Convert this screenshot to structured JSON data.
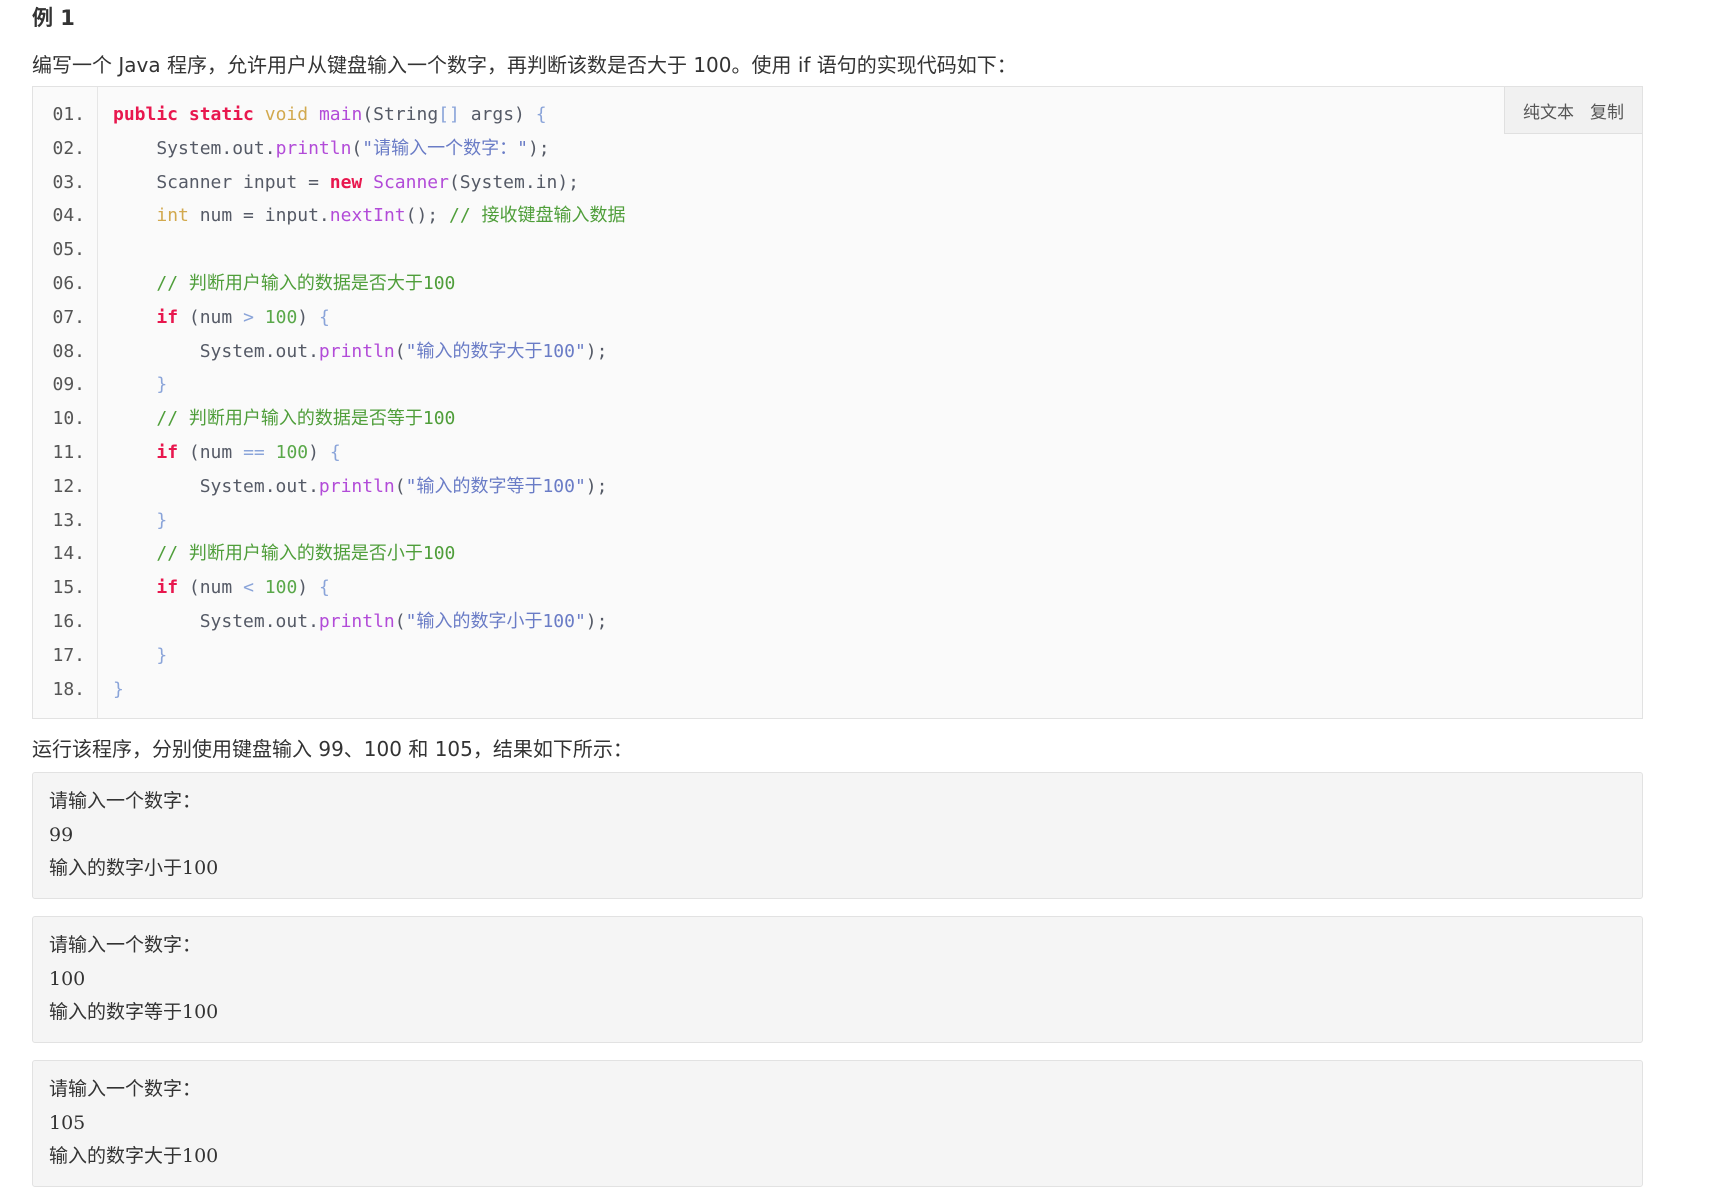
{
  "heading": "例 1",
  "intro": "编写一个 Java 程序，允许用户从键盘输入一个数字，再判断该数是否大于 100。使用 if 语句的实现代码如下：",
  "toolbar": {
    "plain_text_label": "纯文本",
    "copy_label": "复制"
  },
  "code": {
    "lines": [
      {
        "num": "01.",
        "tokens": [
          {
            "t": "public",
            "c": "keyword"
          },
          {
            "t": " ",
            "c": "plain"
          },
          {
            "t": "static",
            "c": "keyword"
          },
          {
            "t": " ",
            "c": "plain"
          },
          {
            "t": "void",
            "c": "type"
          },
          {
            "t": " ",
            "c": "plain"
          },
          {
            "t": "main",
            "c": "func"
          },
          {
            "t": "(String",
            "c": "plain"
          },
          {
            "t": "[]",
            "c": "punct"
          },
          {
            "t": " args) ",
            "c": "plain"
          },
          {
            "t": "{",
            "c": "punct"
          }
        ]
      },
      {
        "num": "02.",
        "tokens": [
          {
            "t": "    System.out.",
            "c": "plain"
          },
          {
            "t": "println",
            "c": "func"
          },
          {
            "t": "(",
            "c": "plain"
          },
          {
            "t": "\"请输入一个数字：\"",
            "c": "string"
          },
          {
            "t": ");",
            "c": "plain"
          }
        ]
      },
      {
        "num": "03.",
        "tokens": [
          {
            "t": "    Scanner input = ",
            "c": "plain"
          },
          {
            "t": "new",
            "c": "new"
          },
          {
            "t": " ",
            "c": "plain"
          },
          {
            "t": "Scanner",
            "c": "class"
          },
          {
            "t": "(System.in);",
            "c": "plain"
          }
        ]
      },
      {
        "num": "04.",
        "tokens": [
          {
            "t": "    ",
            "c": "plain"
          },
          {
            "t": "int",
            "c": "type"
          },
          {
            "t": " num = input.",
            "c": "plain"
          },
          {
            "t": "nextInt",
            "c": "func"
          },
          {
            "t": "(); ",
            "c": "plain"
          },
          {
            "t": "// 接收键盘输入数据",
            "c": "comment"
          }
        ]
      },
      {
        "num": "05.",
        "tokens": []
      },
      {
        "num": "06.",
        "tokens": [
          {
            "t": "    ",
            "c": "plain"
          },
          {
            "t": "// 判断用户输入的数据是否大于100",
            "c": "comment"
          }
        ]
      },
      {
        "num": "07.",
        "tokens": [
          {
            "t": "    ",
            "c": "plain"
          },
          {
            "t": "if",
            "c": "keyword"
          },
          {
            "t": " (num ",
            "c": "plain"
          },
          {
            "t": ">",
            "c": "punct"
          },
          {
            "t": " ",
            "c": "plain"
          },
          {
            "t": "100",
            "c": "number"
          },
          {
            "t": ") ",
            "c": "plain"
          },
          {
            "t": "{",
            "c": "punct"
          }
        ]
      },
      {
        "num": "08.",
        "tokens": [
          {
            "t": "        System.out.",
            "c": "plain"
          },
          {
            "t": "println",
            "c": "func"
          },
          {
            "t": "(",
            "c": "plain"
          },
          {
            "t": "\"输入的数字大于100\"",
            "c": "string"
          },
          {
            "t": ");",
            "c": "plain"
          }
        ]
      },
      {
        "num": "09.",
        "tokens": [
          {
            "t": "    ",
            "c": "plain"
          },
          {
            "t": "}",
            "c": "punct"
          }
        ]
      },
      {
        "num": "10.",
        "tokens": [
          {
            "t": "    ",
            "c": "plain"
          },
          {
            "t": "// 判断用户输入的数据是否等于100",
            "c": "comment"
          }
        ]
      },
      {
        "num": "11.",
        "tokens": [
          {
            "t": "    ",
            "c": "plain"
          },
          {
            "t": "if",
            "c": "keyword"
          },
          {
            "t": " (num ",
            "c": "plain"
          },
          {
            "t": "==",
            "c": "punct"
          },
          {
            "t": " ",
            "c": "plain"
          },
          {
            "t": "100",
            "c": "number"
          },
          {
            "t": ") ",
            "c": "plain"
          },
          {
            "t": "{",
            "c": "punct"
          }
        ]
      },
      {
        "num": "12.",
        "tokens": [
          {
            "t": "        System.out.",
            "c": "plain"
          },
          {
            "t": "println",
            "c": "func"
          },
          {
            "t": "(",
            "c": "plain"
          },
          {
            "t": "\"输入的数字等于100\"",
            "c": "string"
          },
          {
            "t": ");",
            "c": "plain"
          }
        ]
      },
      {
        "num": "13.",
        "tokens": [
          {
            "t": "    ",
            "c": "plain"
          },
          {
            "t": "}",
            "c": "punct"
          }
        ]
      },
      {
        "num": "14.",
        "tokens": [
          {
            "t": "    ",
            "c": "plain"
          },
          {
            "t": "// 判断用户输入的数据是否小于100",
            "c": "comment"
          }
        ]
      },
      {
        "num": "15.",
        "tokens": [
          {
            "t": "    ",
            "c": "plain"
          },
          {
            "t": "if",
            "c": "keyword"
          },
          {
            "t": " (num ",
            "c": "plain"
          },
          {
            "t": "<",
            "c": "punct"
          },
          {
            "t": " ",
            "c": "plain"
          },
          {
            "t": "100",
            "c": "number"
          },
          {
            "t": ") ",
            "c": "plain"
          },
          {
            "t": "{",
            "c": "punct"
          }
        ]
      },
      {
        "num": "16.",
        "tokens": [
          {
            "t": "        System.out.",
            "c": "plain"
          },
          {
            "t": "println",
            "c": "func"
          },
          {
            "t": "(",
            "c": "plain"
          },
          {
            "t": "\"输入的数字小于100\"",
            "c": "string"
          },
          {
            "t": ");",
            "c": "plain"
          }
        ]
      },
      {
        "num": "17.",
        "tokens": [
          {
            "t": "    ",
            "c": "plain"
          },
          {
            "t": "}",
            "c": "punct"
          }
        ]
      },
      {
        "num": "18.",
        "tokens": [
          {
            "t": "}",
            "c": "punct"
          }
        ]
      }
    ]
  },
  "result_intro": "运行该程序，分别使用键盘输入 99、100 和 105，结果如下所示：",
  "outputs": [
    {
      "lines": [
        "请输入一个数字：",
        "99",
        "输入的数字小于100"
      ]
    },
    {
      "lines": [
        "请输入一个数字：",
        "100",
        "输入的数字等于100"
      ]
    },
    {
      "lines": [
        "请输入一个数字：",
        "105",
        "输入的数字大于100"
      ]
    }
  ],
  "colors": {
    "keyword": "#e8174e",
    "type": "#d2a94e",
    "function": "#b24bd8",
    "string": "#6a7cc6",
    "number": "#5aa84a",
    "comment": "#4f9e3a",
    "code_background": "#fafafa",
    "output_background": "#f5f5f5"
  }
}
